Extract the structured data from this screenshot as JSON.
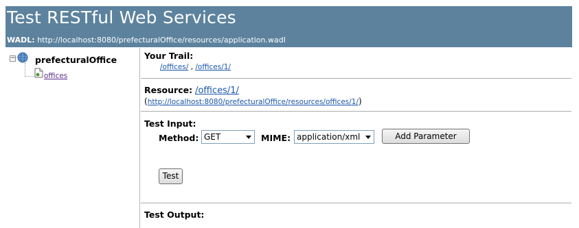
{
  "header": {
    "title": "Test RESTful Web Services",
    "wadl_label": "WADL:",
    "wadl_url": "http://localhost:8080/prefecturalOffice/resources/application.wadl",
    "bg_color": "#5c829e"
  },
  "tree": {
    "expander_symbol": "−",
    "root_icon": "globe-icon",
    "root_label": "prefecturalOffice",
    "child_icon": "page-icon",
    "child_label": "offices"
  },
  "trail": {
    "label": "Your Trail:",
    "links": [
      "/offices/",
      "/offices/1/"
    ],
    "separator": ","
  },
  "resource": {
    "label": "Resource:",
    "path": "/offices/1/",
    "url": "http://localhost:8080/prefecturalOffice/resources/offices/1/",
    "open_paren": "(",
    "close_paren": ")"
  },
  "test_input": {
    "label": "Test Input:",
    "method_label": "Method:",
    "method_value": "GET",
    "mime_label": "MIME:",
    "mime_value": "application/xml",
    "add_param_label": "Add Parameter",
    "test_label": "Test"
  },
  "test_output": {
    "label": "Test Output:"
  }
}
